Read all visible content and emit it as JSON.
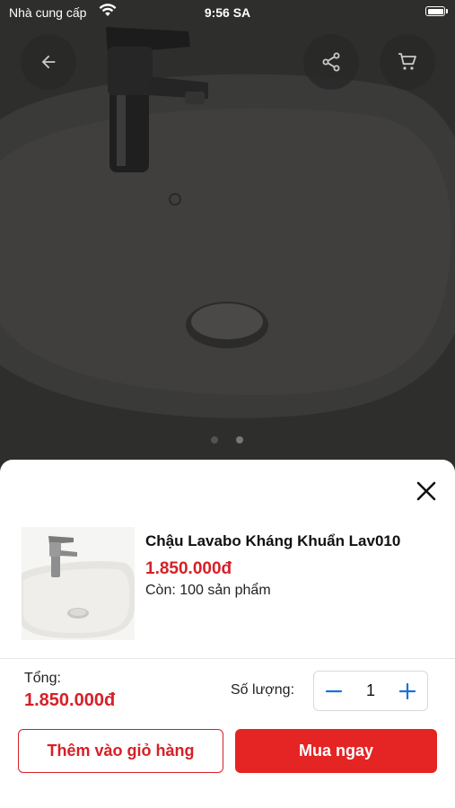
{
  "status_bar": {
    "carrier": "Nhà cung cấp",
    "time": "9:56 SA"
  },
  "icons": {
    "back": "arrow-left-icon",
    "share": "share-icon",
    "cart": "cart-icon",
    "close": "close-icon",
    "minus": "minus-icon",
    "plus": "plus-icon",
    "wifi": "wifi-icon",
    "battery": "battery-icon"
  },
  "gallery": {
    "page_count": 2,
    "current_page": 2
  },
  "product": {
    "name": "Chậu Lavabo Kháng Khuẩn Lav010",
    "price": "1.850.000đ",
    "stock": "Còn: 100 sản phẩm"
  },
  "order": {
    "total_label": "Tổng:",
    "total_value": "1.850.000đ",
    "quantity_label": "Số lượng:",
    "quantity": "1"
  },
  "actions": {
    "add_to_cart": "Thêm vào giỏ hàng",
    "buy_now": "Mua ngay"
  },
  "colors": {
    "accent": "#e52424",
    "price": "#d62027",
    "stepper_icon": "#1a73d9"
  }
}
